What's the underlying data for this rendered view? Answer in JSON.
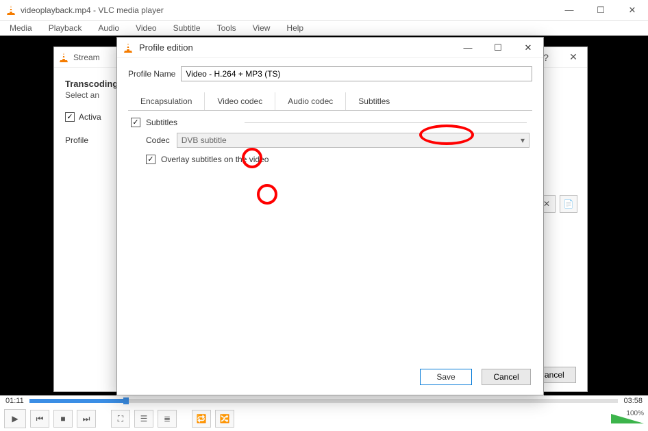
{
  "window": {
    "title": "videoplayback.mp4 - VLC media player"
  },
  "menubar": {
    "items": [
      "Media",
      "Playback",
      "Audio",
      "Video",
      "Subtitle",
      "Tools",
      "View",
      "Help"
    ]
  },
  "stream_dialog": {
    "title": "Stream",
    "heading": "Transcoding",
    "subtext": "Select an",
    "activate_label": "Activa",
    "profile_label": "Profile",
    "cancel": "Cancel"
  },
  "profile_dialog": {
    "title": "Profile edition",
    "profile_name_label": "Profile Name",
    "profile_name_value": "Video - H.264 + MP3 (TS)",
    "tabs": {
      "encapsulation": "Encapsulation",
      "video_codec": "Video codec",
      "audio_codec": "Audio codec",
      "subtitles": "Subtitles"
    },
    "subtitles_checkbox": "Subtitles",
    "codec_label": "Codec",
    "codec_value": "DVB subtitle",
    "overlay_label": "Overlay subtitles on the video",
    "save": "Save",
    "cancel": "Cancel"
  },
  "playback": {
    "current": "01:11",
    "total": "03:58",
    "volume": "100%"
  }
}
